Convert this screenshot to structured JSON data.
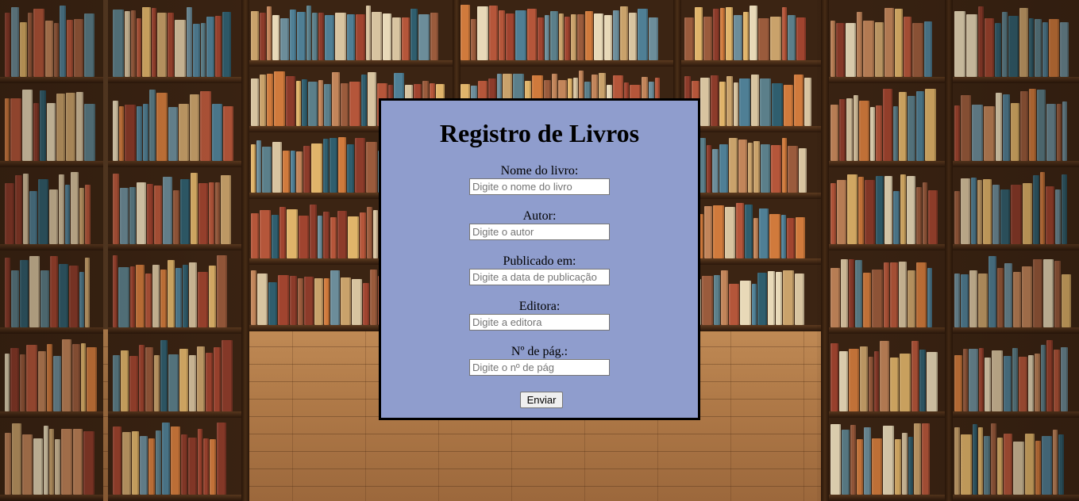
{
  "form": {
    "title": "Registro de Livros",
    "fields": [
      {
        "label": "Nome do livro:",
        "placeholder": "Digite o nome do livro",
        "value": ""
      },
      {
        "label": "Autor:",
        "placeholder": "Digite o autor",
        "value": ""
      },
      {
        "label": "Publicado em:",
        "placeholder": "Digite a data de publicação",
        "value": ""
      },
      {
        "label": "Editora:",
        "placeholder": "Digite a editora",
        "value": ""
      },
      {
        "label": "Nº de pág.:",
        "placeholder": "Digite o nº de pág",
        "value": ""
      }
    ],
    "submit_label": "Enviar"
  },
  "colors": {
    "panel_background": "#8f9dcd",
    "panel_border": "#000000"
  }
}
